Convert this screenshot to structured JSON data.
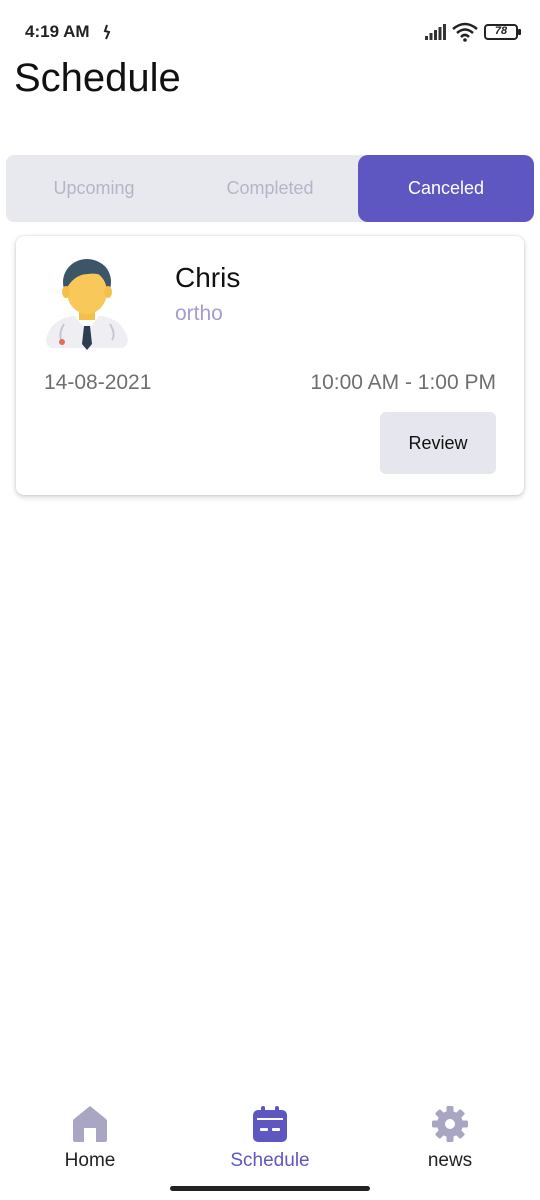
{
  "status_bar": {
    "time": "4:19 AM",
    "battery": "78",
    "icons": [
      "dnd-icon",
      "signal-icon",
      "wifi-icon",
      "battery-icon"
    ]
  },
  "page": {
    "title": "Schedule"
  },
  "tabs": [
    {
      "label": "Upcoming",
      "active": false
    },
    {
      "label": "Completed",
      "active": false
    },
    {
      "label": "Canceled",
      "active": true
    }
  ],
  "appointments": [
    {
      "doctor_name": "Chris",
      "specialty": "ortho",
      "date": "14-08-2021",
      "time": "10:00 AM - 1:00 PM",
      "action_label": "Review",
      "avatar_icon": "doctor-avatar-icon"
    }
  ],
  "bottom_nav": [
    {
      "label": "Home",
      "icon": "home-icon",
      "active": false
    },
    {
      "label": "Schedule",
      "icon": "calendar-icon",
      "active": true
    },
    {
      "label": "news",
      "icon": "gear-icon",
      "active": false
    }
  ],
  "colors": {
    "accent": "#5e57c2",
    "tab_inactive_text": "#b5b5c8",
    "tab_bar_bg": "#e8e8ef",
    "specialty_text": "#a59cd3",
    "nav_inactive_icon": "#a9a6c4"
  }
}
